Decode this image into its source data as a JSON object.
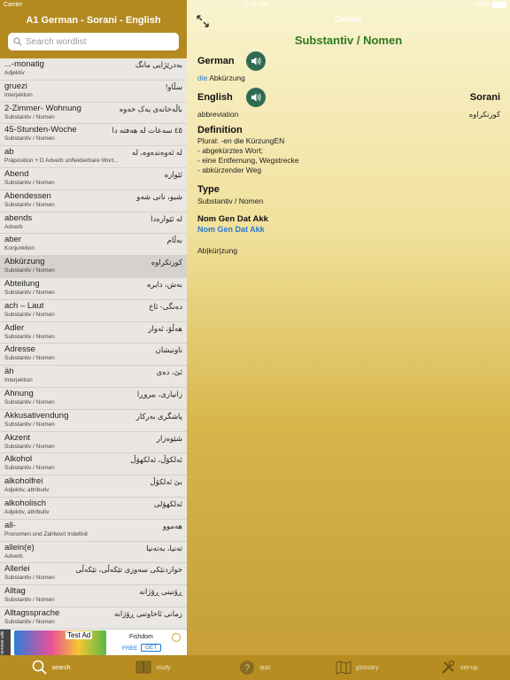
{
  "status_bar": {
    "carrier": "Carrier",
    "time": "12:11 AM",
    "battery": "100%"
  },
  "left": {
    "app_title": "A1 German - Sorani - English",
    "search_placeholder": "Search wordlist",
    "words": [
      {
        "de": "...-monatig",
        "type": "Adjektiv",
        "ku": "بەدرێژایی مانگ"
      },
      {
        "de": "gruezi",
        "type": "Interjektion",
        "ku": "سڵاو!"
      },
      {
        "de": "2-Zimmer- Wohnung",
        "type": "Substantiv / Nomen",
        "ku": "باڵەخانەی یەک خەوە"
      },
      {
        "de": "45-Stunden-Woche",
        "type": "Substantiv / Nomen",
        "ku": "٤٥ سەعات لە هەفتە دا"
      },
      {
        "de": "ab",
        "type": "Präposition + D Adverb unflektierbare Wort...",
        "ku": "لە ئەوەندەوە، لە"
      },
      {
        "de": "Abend",
        "type": "Substantiv / Nomen",
        "ku": "ئێوارە"
      },
      {
        "de": "Abendessen",
        "type": "Substantiv / Nomen",
        "ku": "شیو، نانی شەو"
      },
      {
        "de": "abends",
        "type": "Adverb",
        "ku": "لە ئێوارەدا"
      },
      {
        "de": "aber",
        "type": "Konjunktion",
        "ku": "بەڵام"
      },
      {
        "de": "Abkürzung",
        "type": "Substantiv / Nomen",
        "ku": "کورتکراوە",
        "selected": true
      },
      {
        "de": "Abteilung",
        "type": "Substantiv / Nomen",
        "ku": "بەش، دایرە"
      },
      {
        "de": "ach – Laut",
        "type": "Substantiv / Nomen",
        "ku": "دەنگی- ئاخ"
      },
      {
        "de": "Adler",
        "type": "Substantiv / Nomen",
        "ku": "هەڵۆ، ئەوار"
      },
      {
        "de": "Adresse",
        "type": "Substantiv / Nomen",
        "ku": "ناونیشان"
      },
      {
        "de": "äh",
        "type": "Interjektion",
        "ku": "ئێ، دەی"
      },
      {
        "de": "Ahnung",
        "type": "Substantiv / Nomen",
        "ku": "زانیاری، بیروڕا"
      },
      {
        "de": "Akkusativendung",
        "type": "Substantiv / Nomen",
        "ku": "پاشگری بەرکار"
      },
      {
        "de": "Akzent",
        "type": "Substantiv / Nomen",
        "ku": "شێوەزار"
      },
      {
        "de": "Alkohol",
        "type": "Substantiv / Nomen",
        "ku": "ئەلکۆڵ، ئەلکهۆڵ"
      },
      {
        "de": "alkoholfrei",
        "type": "Adjektiv, attributiv",
        "ku": "بێ ئەلکۆڵ"
      },
      {
        "de": "alkoholisch",
        "type": "Adjektiv, attributiv",
        "ku": "ئەلکهۆلی"
      },
      {
        "de": "all-",
        "type": "Pronomen und Zahlwort Indefinit",
        "ku": "هەموو"
      },
      {
        "de": "allein(e)",
        "type": "Adverb",
        "ku": "تەنیا، بەتەنیا"
      },
      {
        "de": "Allerlei",
        "type": "Substantiv / Nomen",
        "ku": "خواردنێکی سەوزی تێکەڵی، تێکەڵی"
      },
      {
        "de": "Alltag",
        "type": "Substantiv / Nomen",
        "ku": "ڕۆتینی ڕۆژانە"
      },
      {
        "de": "Alltagssprache",
        "type": "Substantiv / Nomen",
        "ku": "زمانی ئاخاوتنی ڕۆژانە"
      }
    ],
    "ad": {
      "remove_label": "remove ads",
      "test_ad": "Test Ad",
      "app_name": "Fishdom",
      "free": "FREE",
      "get": "GET"
    }
  },
  "detail": {
    "header": "Details",
    "word_type": "Substantiv / Nomen",
    "german_label": "German",
    "article": "die",
    "german_word": "Abkürzung",
    "english_label": "English",
    "sorani_label": "Sorani",
    "english_word": "abbreviation",
    "sorani_word": "کورتکراوە",
    "definition_label": "Definition",
    "definition_text": "Plural: -en die KürzungEN\n- abgekürztes Wort;\n- eine Entfernung, Wegstrecke\n- abkürzender Weg",
    "type_label": "Type",
    "type_value": "Substantiv / Nomen",
    "cases_label": "Nom Gen Dat Akk",
    "cases_value": "Nom Gen Dat Akk",
    "syllables": "Ab|kür|zung"
  },
  "tabs": [
    {
      "id": "search",
      "label": "search",
      "icon": "search-icon"
    },
    {
      "id": "study",
      "label": "study",
      "icon": "book-icon"
    },
    {
      "id": "quiz",
      "label": "quiz",
      "icon": "question-icon"
    },
    {
      "id": "glossary",
      "label": "glossary",
      "icon": "map-icon"
    },
    {
      "id": "setup",
      "label": "set-up",
      "icon": "tools-icon"
    }
  ]
}
